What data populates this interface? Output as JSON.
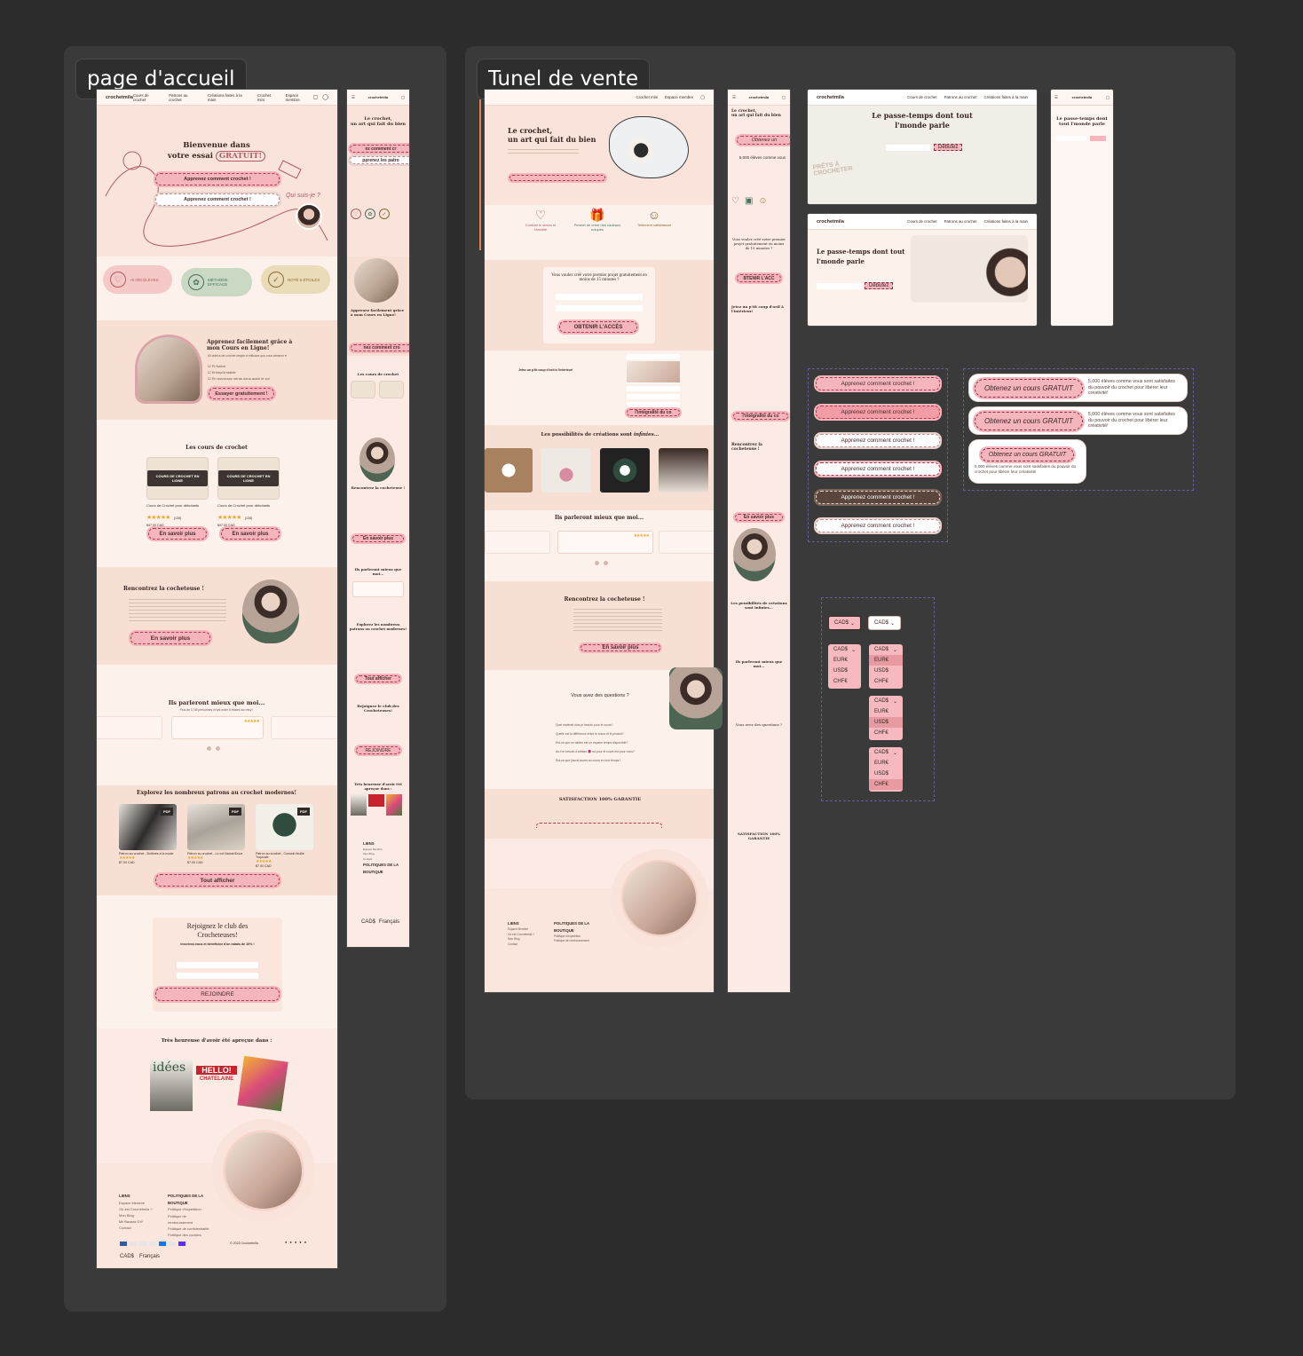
{
  "sections": {
    "home": "page d'accueil",
    "funnel": "Tunel de vente"
  },
  "brand": "crochetmila",
  "nav": {
    "courses": "Cours de crochet",
    "patterns": "Patrons au crochet",
    "creations": "Créations faites à la main",
    "tiny": "Crochet mini",
    "space": "Espace membre"
  },
  "home": {
    "hero_title_1": "Bienvenue dans",
    "hero_title_2": "votre essai",
    "hero_free": "GRATUIT!",
    "cta_learn": "Apprenez comment crochet !",
    "who": "Qui suis-je ?",
    "stat1": "+5 000 ÉLÈVES",
    "stat2": "MÉTHODE EFFICACE",
    "stat3": "NOTÉ 5 ÉTOILES",
    "learn_title": "Apprenez facilement grâce à mon Cours en Ligne!",
    "learn_sub": "60 vidéos de crochet simple et efficace que vous aimerez ♥",
    "check1": "Ft Naturi",
    "check2": "Entrepôt stable",
    "check3": "En nouveaux seras dans aussi le soi",
    "try_free": "Essayer gratuitement !",
    "courses_title": "Les cours de crochet",
    "course_img": "COURS DE CROCHET EN LIGNE",
    "course1_name": "Cours de Crochet pour débutants",
    "course1_price": "$47.00 CAD",
    "course2_name": "Cours de Crochet pour débutants",
    "course2_price": "$47.00 CAD",
    "reviews_count": "(128)",
    "more": "En savoir plus",
    "meet_title": "Rencontrez la cocheteuse !",
    "reviews_title": "Ils parleront mieux que moi...",
    "reviews_sub": "Plus de 1745 personnes m'ont noter 5 étoiles sur etsy !",
    "patterns_title": "Explorez les nombreux patrons au crochet modernes!",
    "pdf": "PDF",
    "pattern1": "Patron au crochet - Bottines à la mode",
    "pattern2": "Patron au crochet - Le col Nature/Doux",
    "pattern3": "Patron au crochet - Coussin feuille Tropicale",
    "pattern_price": "$7.00 CAD",
    "show_all": "Tout afficher",
    "club_title_1": "Rejoignez le club des",
    "club_title_2": "Crocheteuses!",
    "club_sub": "Inscrivez-vous et bénéficiez d'un rabais de 10% !",
    "join": "REJOINDRE",
    "press_title": "Très heureuse d'avoir été apreçue dans :",
    "press1": "idées",
    "press2": "HELLO!",
    "press2b": "CHATELAINE",
    "links": "LIENS",
    "policies": "POLITIQUES DE LA BOUTIQUE",
    "link_items": [
      "Espace Membre",
      "Où est Crochetmila ?",
      "Mon Blog",
      "Mil Bazaaz DIY",
      "Contact"
    ],
    "policy_items": [
      "Politique d'expédition",
      "Politique de remboursement",
      "Politique de confidentialité",
      "Politique des cookies"
    ],
    "currency": "CAD$",
    "language": "Français",
    "copyright": "© 2023 Crochetmila"
  },
  "funnel": {
    "hero_title_1": "Le crochet,",
    "hero_title_2": "un art qui fait du bien",
    "benefit1": "Combat le stress et l'anxiété",
    "benefit2": "Permet de créer des cadeaux uniques",
    "benefit3": "Tellement satisfaisant",
    "form_title": "Vous voulez créé votre premier projet gratuitement en moins de 15 minutes ?",
    "get_access": "OBTENIR L'ACCÈS",
    "preview_title": "Jetez un p'tit coup d'oeil à l'intérieur!",
    "full": "l'intégralité du co",
    "possibilities_title": "Les possibilités de créations sont",
    "possibilities_em": "infinies...",
    "reviews_title": "Ils parleront mieux que moi...",
    "meet_title": "Rencontrez la cocheteuse !",
    "more": "En savoir plus",
    "faq_title": "Vous avez des questions ?",
    "faq": [
      "Quel matériel dois-je besoin pour le cours?",
      "Quelle est la différence entre le cours et le produit?",
      "Est-ce que ce tablier est un espace temps disponible?",
      "As-t'on besoin d'artisan 🧶 ou pour le cours est pour nous?",
      "Est-ce que j'aurai accès au cours en tout temps?"
    ],
    "guarantee": "SATISFACTION 100% GARANTIE",
    "links": "LIENS",
    "policies": "POLITIQUES DE LA BOUTIQUE",
    "mobile_cta": "Obtenez un",
    "mobile_students": "5,000 élèves comme vous",
    "mobile_access": "BTENIR L'ACC",
    "desk_title_1": "Le passe-temps dont tout",
    "desk_title_2": "l'monde parle",
    "desk_cta": "Débutez",
    "ready": "PRÊTS À CROCHETER"
  },
  "components": {
    "buttons": [
      "Apprenez comment crochet !",
      "Apprenez comment crochet !",
      "Apprenez comment crochet !",
      "Apprenez comment crochet !",
      "Apprenez comment crochet !",
      "Apprenez comment crochet !"
    ],
    "offer_btn": "Obtenez un cours GRATUIT",
    "offer_txt": "5,000 élèves comme vous sont satisfaites du pouvoir du crochet pour libérer leur créativité!",
    "currencies": [
      "CAD$",
      "EUR€",
      "USD$",
      "CHF€"
    ],
    "selected": "CAD$"
  },
  "colors": {
    "bg": "#2c2c2c",
    "section": "#3a3a3a",
    "cream": "#fdf1ec",
    "pink_btn": "#f4b5bd",
    "accent": "#b23a4f"
  }
}
